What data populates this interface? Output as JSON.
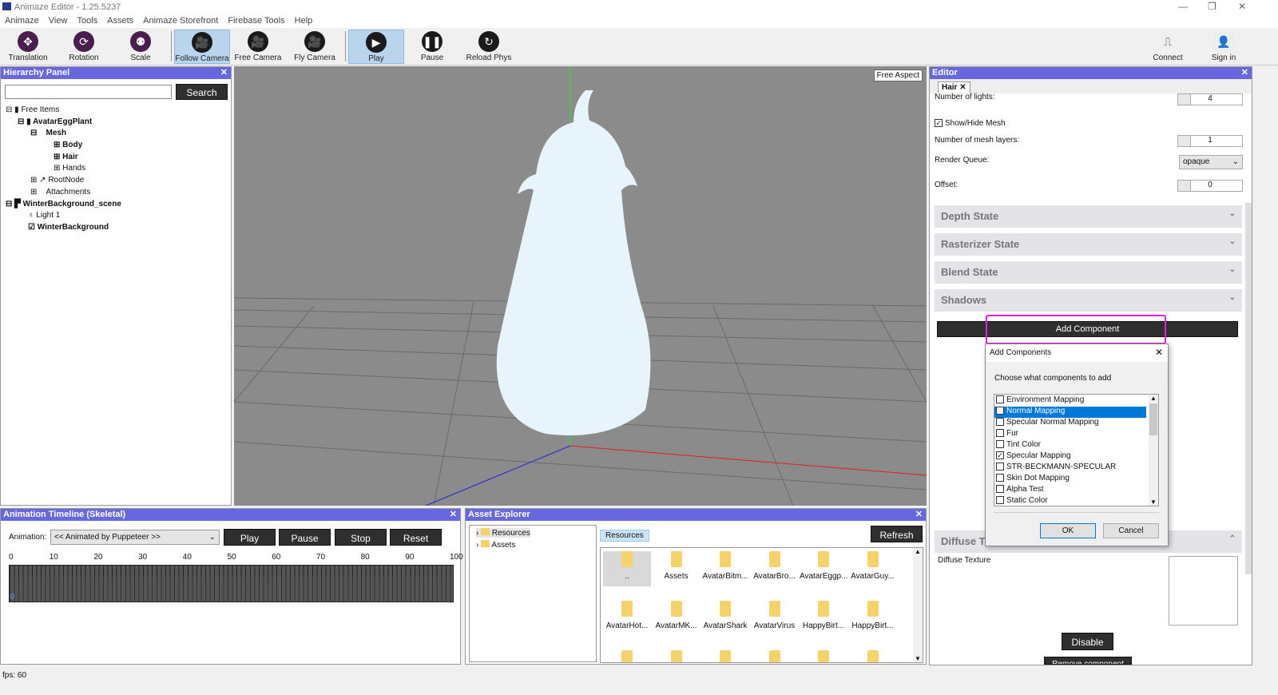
{
  "app": {
    "title": "Animaze Editor - 1.25.5237"
  },
  "menu": [
    "Animaze",
    "View",
    "Tools",
    "Assets",
    "Animaze Storefront",
    "Firebase Tools",
    "Help"
  ],
  "toolbar": {
    "tools": [
      "Translation",
      "Rotation",
      "Scale",
      "Follow Camera",
      "Free Camera",
      "Fly Camera",
      "Play",
      "Pause",
      "Reload Phys"
    ],
    "connect": "Connect",
    "sign_in": "Sign in"
  },
  "hierarchy": {
    "title": "Hierarchy Panel",
    "search_value": "",
    "search_button": "Search",
    "items": [
      "Free Items",
      "AvatarEggPlant",
      "Mesh",
      "Body",
      "Hair",
      "Hands",
      "RootNode",
      "Attachments",
      "WinterBackground_scene",
      "Light 1",
      "WinterBackground"
    ]
  },
  "viewport": {
    "aspect": "Free Aspect"
  },
  "editor": {
    "title": "Editor",
    "tab": "Hair",
    "num_lights_label": "Number of lights:",
    "num_lights": "4",
    "show_hide_mesh": "Show/Hide Mesh",
    "mesh_layers_label": "Number of mesh layers:",
    "mesh_layers": "1",
    "render_queue_label": "Render Queue:",
    "render_queue": "opaque",
    "offset_label": "Offset:",
    "offset": "0",
    "sections": [
      "Depth State",
      "Rasterizer State",
      "Blend State",
      "Shadows"
    ],
    "add_component": "Add Component",
    "diffuse_section": "Diffuse Te",
    "diffuse_texture": "Diffuse Texture",
    "disable": "Disable",
    "remove": "Remove component"
  },
  "dialog": {
    "title": "Add Components",
    "prompt": "Choose what components to add",
    "ok": "OK",
    "cancel": "Cancel",
    "options": [
      {
        "label": "Environment Mapping",
        "checked": false
      },
      {
        "label": "Normal Mapping",
        "checked": true,
        "selected": true
      },
      {
        "label": "Specular Normal Mapping",
        "checked": false
      },
      {
        "label": "Fur",
        "checked": false
      },
      {
        "label": "Tint Color",
        "checked": false
      },
      {
        "label": "Specular Mapping",
        "checked": true
      },
      {
        "label": "STR-BECKMANN-SPECULAR",
        "checked": false
      },
      {
        "label": "Skin Dot Mapping",
        "checked": false
      },
      {
        "label": "Alpha Test",
        "checked": false
      },
      {
        "label": "Static Color",
        "checked": false
      }
    ]
  },
  "timeline": {
    "title": "Animation Timeline (Skeletal)",
    "animation_label": "Animation:",
    "animation_value": "<< Animated by Puppeteer >>",
    "play": "Play",
    "pause": "Pause",
    "stop": "Stop",
    "reset": "Reset",
    "ticks": [
      "0",
      "10",
      "20",
      "30",
      "40",
      "50",
      "60",
      "70",
      "80",
      "90",
      "100"
    ],
    "cursor": "0"
  },
  "assets": {
    "title": "Asset Explorer",
    "tree": [
      "Resources",
      "Assets"
    ],
    "breadcrumb": "Resources",
    "refresh": "Refresh",
    "folders": [
      "..",
      "Assets",
      "AvatarBitm...",
      "AvatarBro...",
      "AvatarEggp...",
      "AvatarGuy...",
      "AvatarHot...",
      "AvatarMK...",
      "AvatarShark",
      "AvatarVirus",
      "HappyBirt...",
      "HappyBirt..."
    ]
  },
  "status": {
    "fps": "fps: 60"
  },
  "colors": {
    "panel_header": "#6767df",
    "highlight": "#e020e0"
  }
}
